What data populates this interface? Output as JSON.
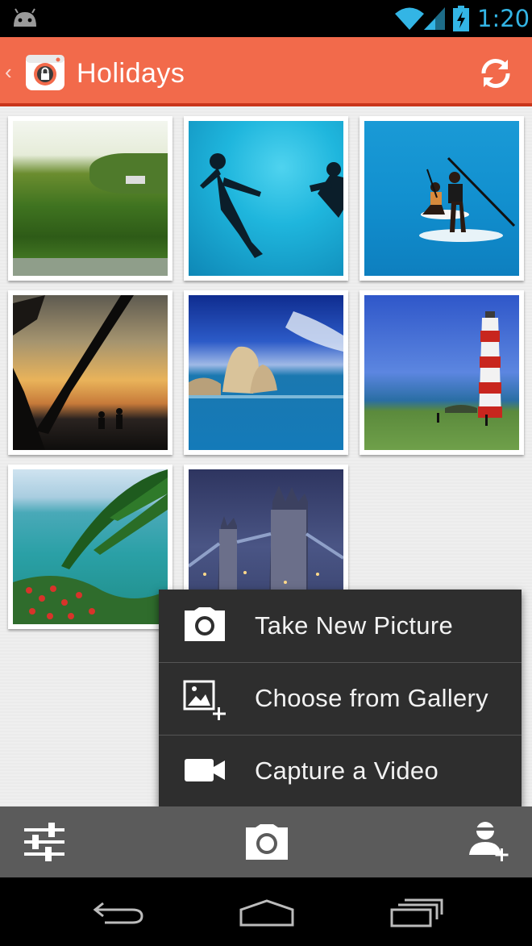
{
  "status_bar": {
    "time": "1:20",
    "icons": [
      "android-icon",
      "wifi-icon",
      "signal-icon",
      "battery-charging-icon"
    ]
  },
  "action_bar": {
    "title": "Holidays",
    "icons": [
      "back-chevron-icon",
      "app-lock-camera-icon",
      "refresh-icon"
    ],
    "color": "#f26a4b"
  },
  "photos": [
    {
      "name": "jungle-road"
    },
    {
      "name": "snorkelers"
    },
    {
      "name": "paddleboarders"
    },
    {
      "name": "palm-sunset"
    },
    {
      "name": "sea-rock"
    },
    {
      "name": "lighthouse"
    },
    {
      "name": "tropical-beach"
    },
    {
      "name": "tower-bridge"
    }
  ],
  "popup_menu": {
    "items": [
      {
        "label": "Take New Picture",
        "icon": "camera-icon"
      },
      {
        "label": "Choose from Gallery",
        "icon": "gallery-add-icon"
      },
      {
        "label": "Capture a Video",
        "icon": "video-camera-icon"
      }
    ]
  },
  "bottom_bar": {
    "icons": [
      "settings-sliders-icon",
      "camera-icon",
      "add-user-icon"
    ]
  },
  "nav_bar": {
    "icons": [
      "back-icon",
      "home-icon",
      "recent-apps-icon"
    ]
  }
}
